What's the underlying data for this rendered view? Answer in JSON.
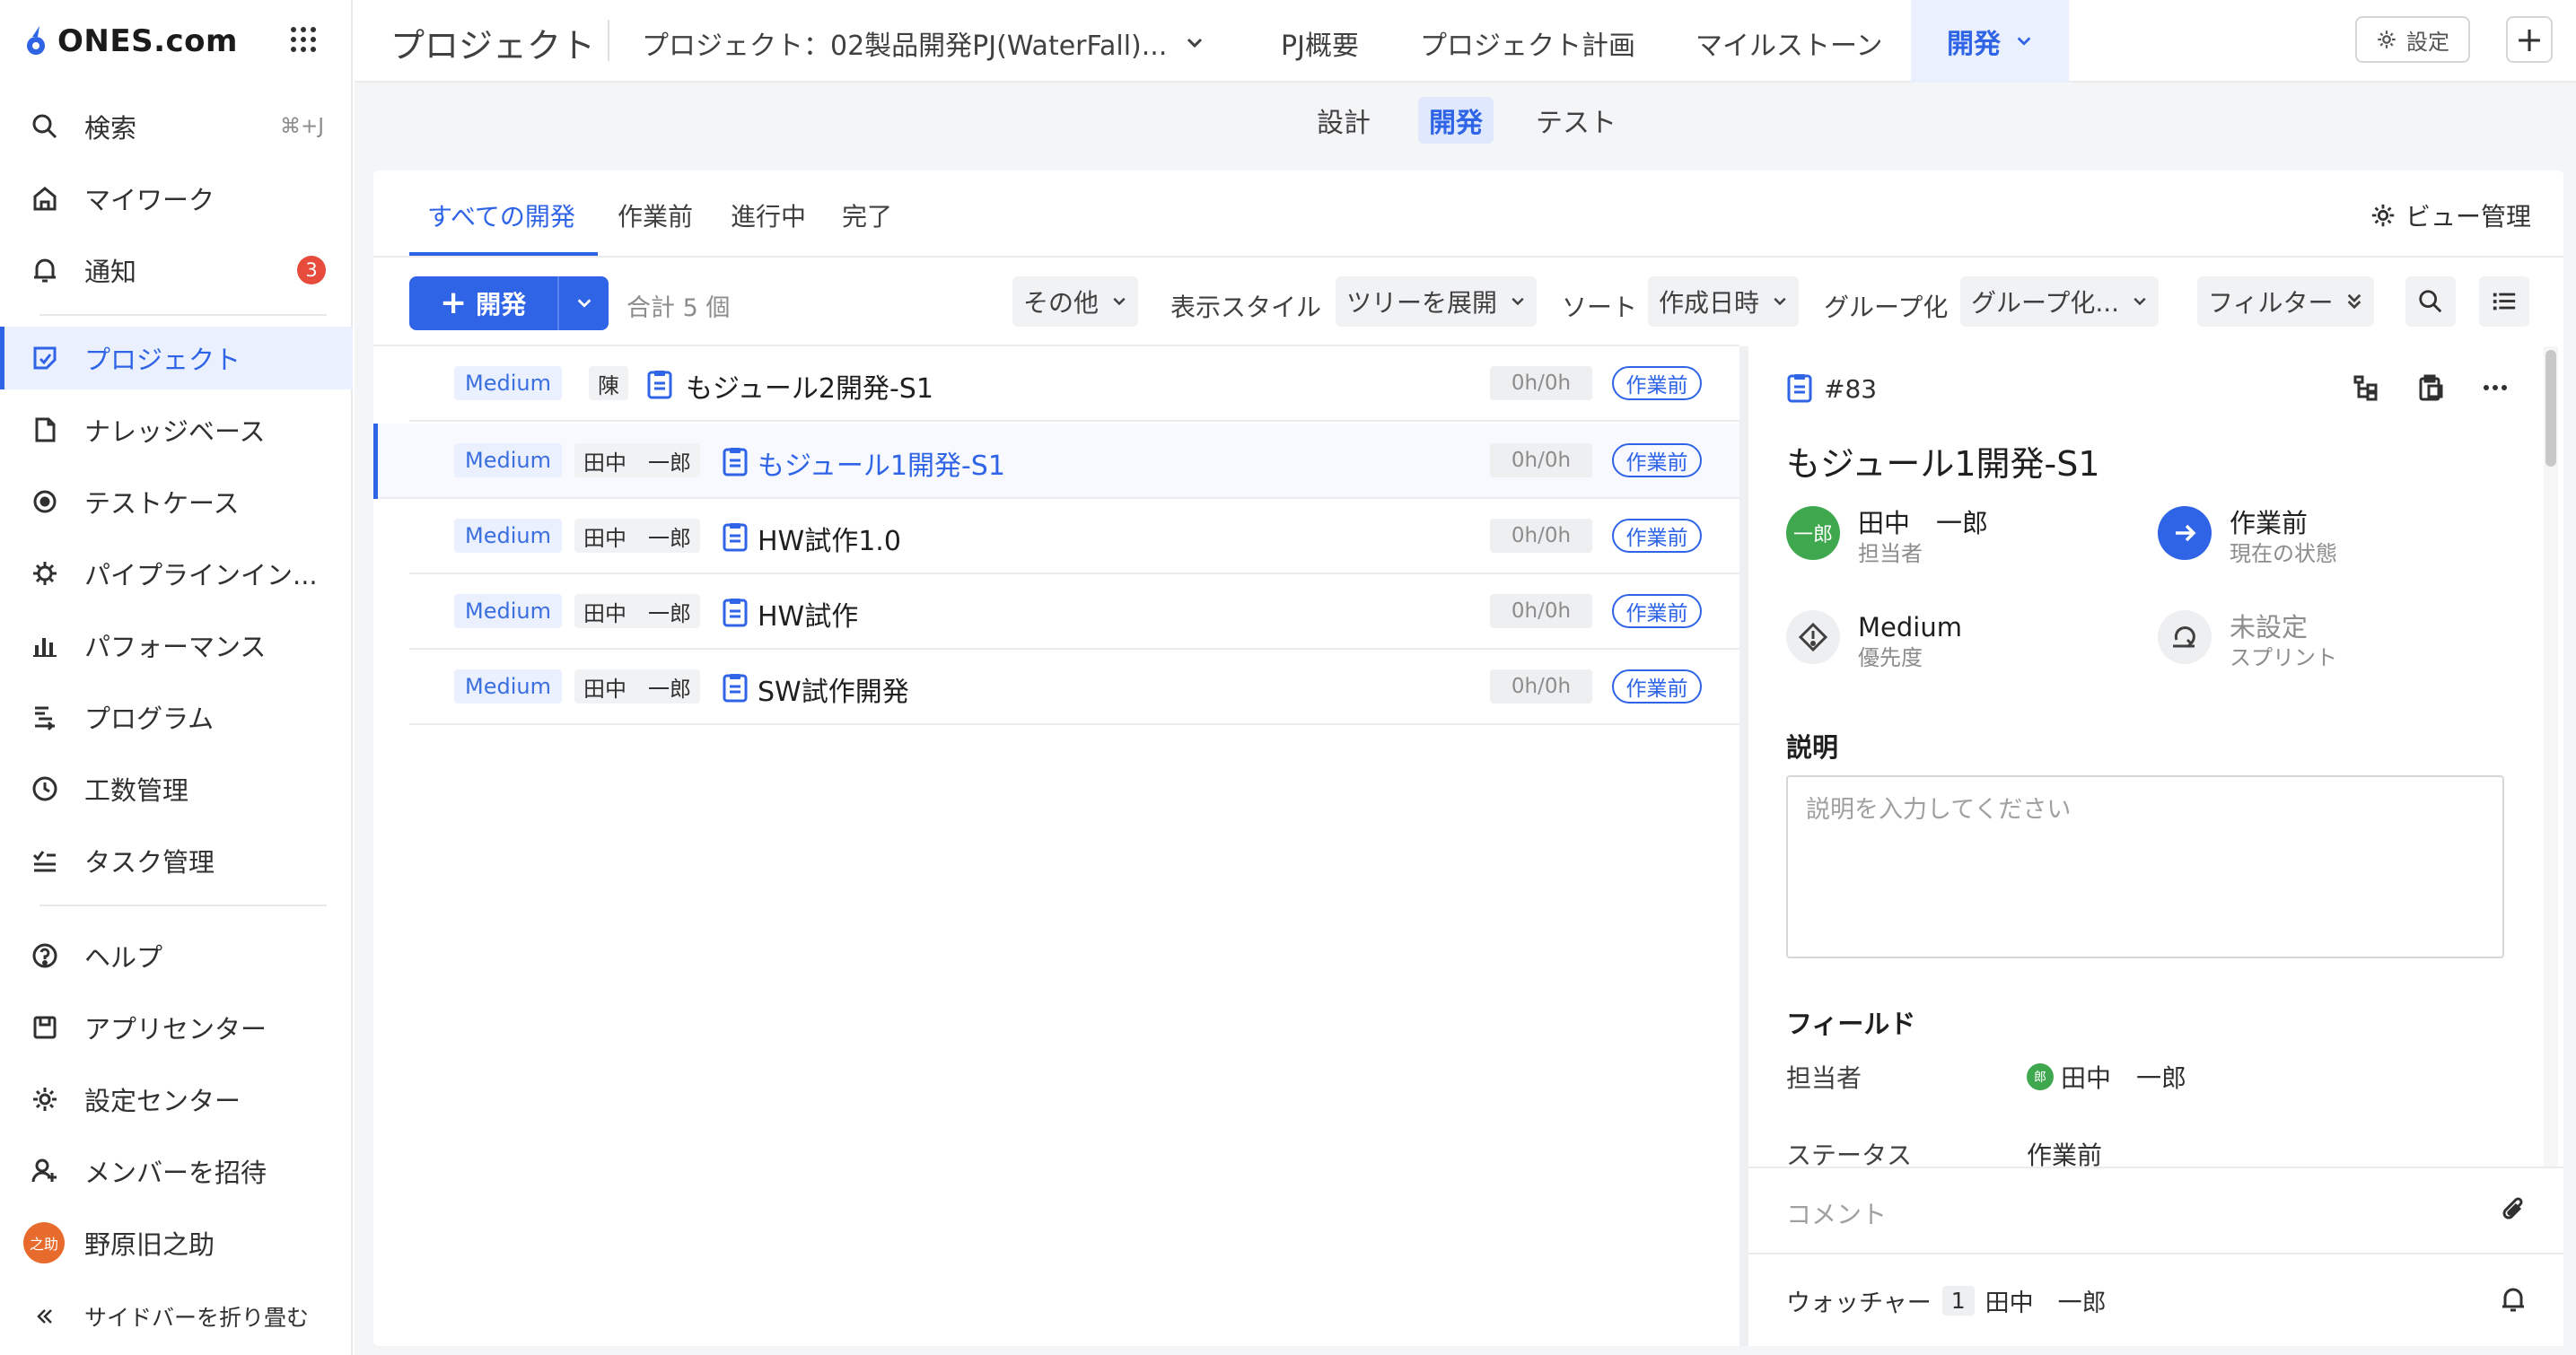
{
  "sidebar": {
    "logo_text": "ONES.com",
    "items": [
      {
        "label": "検索",
        "icon": "search-icon",
        "shortcut": "⌘+J"
      },
      {
        "label": "マイワーク",
        "icon": "home-icon"
      },
      {
        "label": "通知",
        "icon": "bell-icon",
        "badge": "3"
      },
      {
        "label": "プロジェクト",
        "icon": "project-icon"
      },
      {
        "label": "ナレッジベース",
        "icon": "knowledge-icon"
      },
      {
        "label": "テストケース",
        "icon": "testcase-icon"
      },
      {
        "label": "パイプラインイン...",
        "icon": "pipeline-icon"
      },
      {
        "label": "パフォーマンス",
        "icon": "performance-icon"
      },
      {
        "label": "プログラム",
        "icon": "program-icon"
      },
      {
        "label": "工数管理",
        "icon": "clock-icon"
      },
      {
        "label": "タスク管理",
        "icon": "task-icon"
      },
      {
        "label": "ヘルプ",
        "icon": "help-icon"
      },
      {
        "label": "アプリセンター",
        "icon": "app-icon"
      },
      {
        "label": "設定センター",
        "icon": "gear-icon"
      },
      {
        "label": "メンバーを招待",
        "icon": "invite-icon"
      },
      {
        "label": "野原旧之助",
        "avatar": "之助"
      }
    ],
    "collapse_label": "サイドバーを折り畳む"
  },
  "topbar": {
    "title": "プロジェクト",
    "project": "プロジェクト：02製品開発PJ(WaterFall)...",
    "tabs": [
      "PJ概要",
      "プロジェクト計画",
      "マイルストーン",
      "開発"
    ],
    "setting_label": "設定"
  },
  "subnav": {
    "tabs": [
      "設計",
      "開発",
      "テスト"
    ]
  },
  "view_tabs": [
    "すべての開発",
    "作業前",
    "進行中",
    "完了"
  ],
  "view_manage": "ビュー管理",
  "toolbar": {
    "new_label": "開発",
    "count": "合計 5 個",
    "other": "その他",
    "display_style_label": "表示スタイル",
    "display_style_value": "ツリーを展開",
    "sort_label": "ソート",
    "sort_value": "作成日時",
    "group_label": "グループ化",
    "group_value": "グループ化...",
    "filter": "フィルター"
  },
  "rows": [
    {
      "priority": "Medium",
      "assignee": "陳",
      "title": "もジュール2開発-S1",
      "hours": "0h/0h",
      "status": "作業前"
    },
    {
      "priority": "Medium",
      "assignee": "田中　一郎",
      "title": "もジュール1開発-S1",
      "hours": "0h/0h",
      "status": "作業前"
    },
    {
      "priority": "Medium",
      "assignee": "田中　一郎",
      "title": "HW試作1.0",
      "hours": "0h/0h",
      "status": "作業前"
    },
    {
      "priority": "Medium",
      "assignee": "田中　一郎",
      "title": "HW試作",
      "hours": "0h/0h",
      "status": "作業前"
    },
    {
      "priority": "Medium",
      "assignee": "田中　一郎",
      "title": "SW試作開発",
      "hours": "0h/0h",
      "status": "作業前"
    }
  ],
  "detail": {
    "id": "#83",
    "title": "もジュール1開発-S1",
    "assignee": {
      "avatar": "一郎",
      "name": "田中　一郎",
      "label": "担当者"
    },
    "state": {
      "name": "作業前",
      "label": "現在の状態"
    },
    "priority": {
      "name": "Medium",
      "label": "優先度"
    },
    "sprint": {
      "name": "未設定",
      "label": "スプリント"
    },
    "desc_title": "説明",
    "desc_placeholder": "説明を入力してください",
    "fields_title": "フィールド",
    "fields": [
      {
        "label": "担当者",
        "value": "田中　一郎",
        "avatar": "郎"
      },
      {
        "label": "ステータス",
        "value": "作業前"
      }
    ],
    "comment_placeholder": "コメント",
    "watcher_label": "ウォッチャー",
    "watcher_count": "1",
    "watcher_name": "田中　一郎"
  },
  "colors": {
    "accent": "#2f64e6",
    "badge": "#e64b3c",
    "assignee_avatar": "#3fa84e"
  }
}
